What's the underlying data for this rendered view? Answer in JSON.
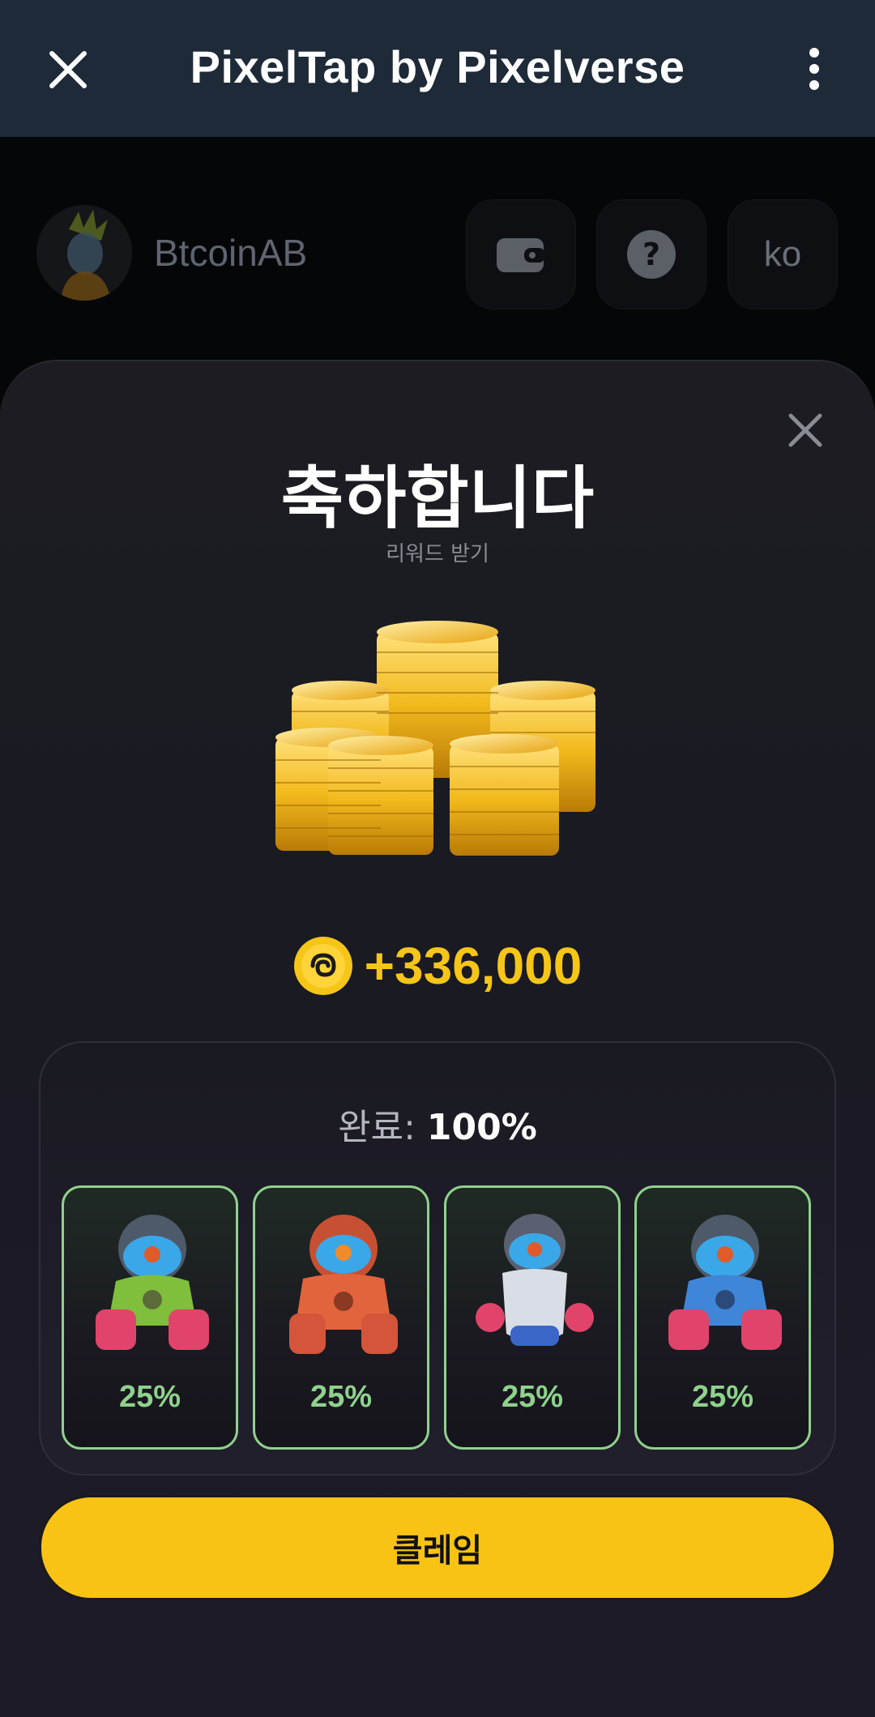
{
  "titlebar": {
    "title": "PixelTap by Pixelverse"
  },
  "header": {
    "username": "BtcoinAB",
    "language": "ko"
  },
  "modal": {
    "title": "축하합니다",
    "subtitle": "리워드 받기",
    "reward_amount": "+336,000",
    "progress_label": "완료:",
    "progress_value": "100%",
    "robots": [
      {
        "percent": "25%",
        "color": "green"
      },
      {
        "percent": "25%",
        "color": "orange"
      },
      {
        "percent": "25%",
        "color": "white"
      },
      {
        "percent": "25%",
        "color": "blue"
      }
    ],
    "claim_label": "클레임"
  },
  "colors": {
    "accent": "#f8c314",
    "success": "#8fd18d",
    "titlebar": "#1e2a38"
  }
}
